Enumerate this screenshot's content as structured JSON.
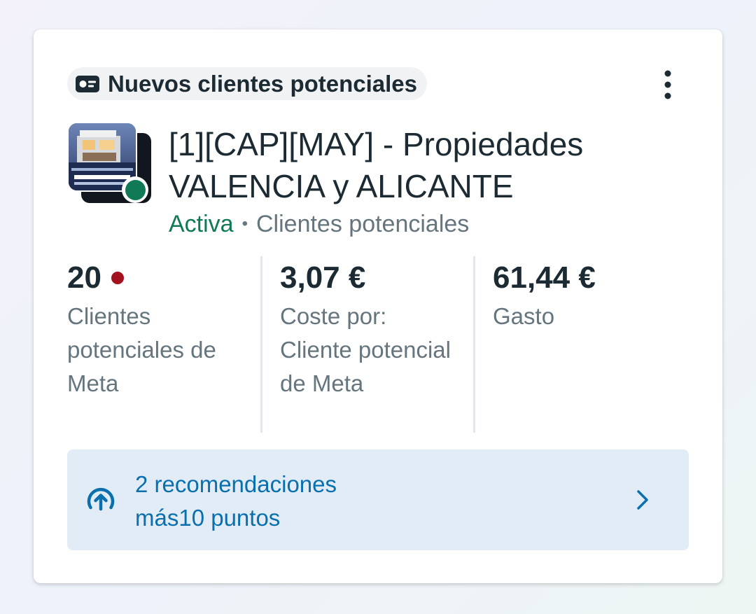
{
  "card": {
    "objective": {
      "icon": "contact-card-icon",
      "label": "Nuevos clientes potenciales"
    },
    "more_button_icon": "more-vertical-icon",
    "campaign": {
      "name": "[1][CAP][MAY] - Propiedades VALENCIA y ALICANTE",
      "thumbnail_text": "VALENCIA Y ALICANTE",
      "status": "Activa",
      "separator": "•",
      "type": "Clientes potenciales",
      "status_color": "#0f7a55"
    },
    "metrics": [
      {
        "value": "20",
        "label": "Clientes potenciales de Meta",
        "alert": true,
        "alert_color": "#a3121f"
      },
      {
        "value": "3,07 €",
        "label": "Coste por: Cliente potencial de Meta"
      },
      {
        "value": "61,44 €",
        "label": "Gasto"
      }
    ],
    "recommendations": {
      "icon": "arrow-up-circle-icon",
      "title": "2 recomendaciones",
      "subtitle": "más10 puntos",
      "chevron_icon": "chevron-right-icon",
      "accent": "#0a6fad",
      "background": "#e1ecf6"
    }
  }
}
